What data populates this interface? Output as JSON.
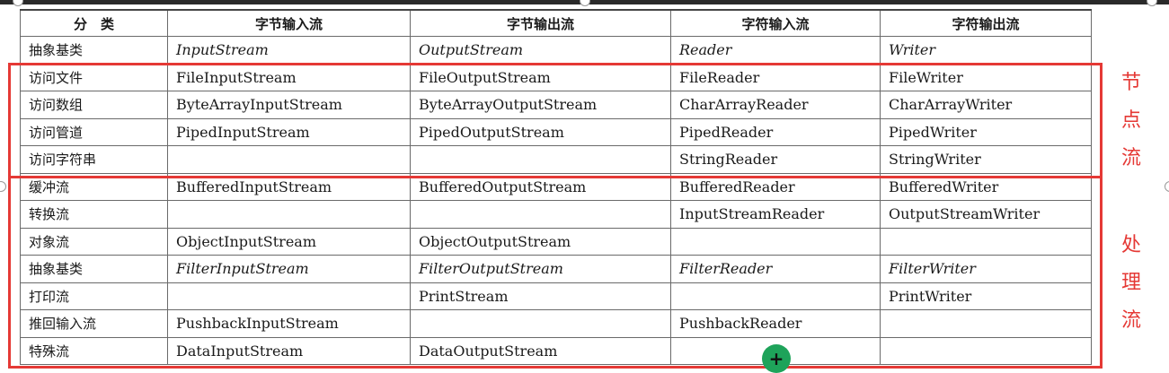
{
  "header": [
    "分　类",
    "字节输入流",
    "字节输出流",
    "字符输入流",
    "字符输出流"
  ],
  "rows": [
    {
      "cat": "抽象基类",
      "cells": [
        "InputStream",
        "OutputStream",
        "Reader",
        "Writer"
      ]
    },
    {
      "cat": "访问文件",
      "cells": [
        "FileInputStream",
        "FileOutputStream",
        "FileReader",
        "FileWriter"
      ]
    },
    {
      "cat": "访问数组",
      "cells": [
        "ByteArrayInputStream",
        "ByteArrayOutputStream",
        "CharArrayReader",
        "CharArrayWriter"
      ]
    },
    {
      "cat": "访问管道",
      "cells": [
        "PipedInputStream",
        "PipedOutputStream",
        "PipedReader",
        "PipedWriter"
      ]
    },
    {
      "cat": "访问字符串",
      "cells": [
        "",
        "",
        "StringReader",
        "StringWriter"
      ]
    },
    {
      "cat": "缓冲流",
      "cells": [
        "BufferedInputStream",
        "BufferedOutputStream",
        "BufferedReader",
        "BufferedWriter"
      ]
    },
    {
      "cat": "转换流",
      "cells": [
        "",
        "",
        "InputStreamReader",
        "OutputStreamWriter"
      ]
    },
    {
      "cat": "对象流",
      "cells": [
        "ObjectInputStream",
        "ObjectOutputStream",
        "",
        ""
      ]
    },
    {
      "cat": "抽象基类",
      "cells": [
        "FilterInputStream",
        "FilterOutputStream",
        "FilterReader",
        "FilterWriter"
      ]
    },
    {
      "cat": "打印流",
      "cells": [
        "",
        "PrintStream",
        "",
        "PrintWriter"
      ]
    },
    {
      "cat": "推回输入流",
      "cells": [
        "PushbackInputStream",
        "",
        "PushbackReader",
        ""
      ]
    },
    {
      "cat": "特殊流",
      "cells": [
        "DataInputStream",
        "DataOutputStream",
        "",
        ""
      ]
    }
  ],
  "annotations": {
    "node_stream": [
      "节",
      "点",
      "流"
    ],
    "processing_stream": [
      "处",
      "理",
      "流"
    ],
    "color": "#e53935"
  },
  "add_button": {
    "label": "+",
    "color": "#1ea35a"
  }
}
